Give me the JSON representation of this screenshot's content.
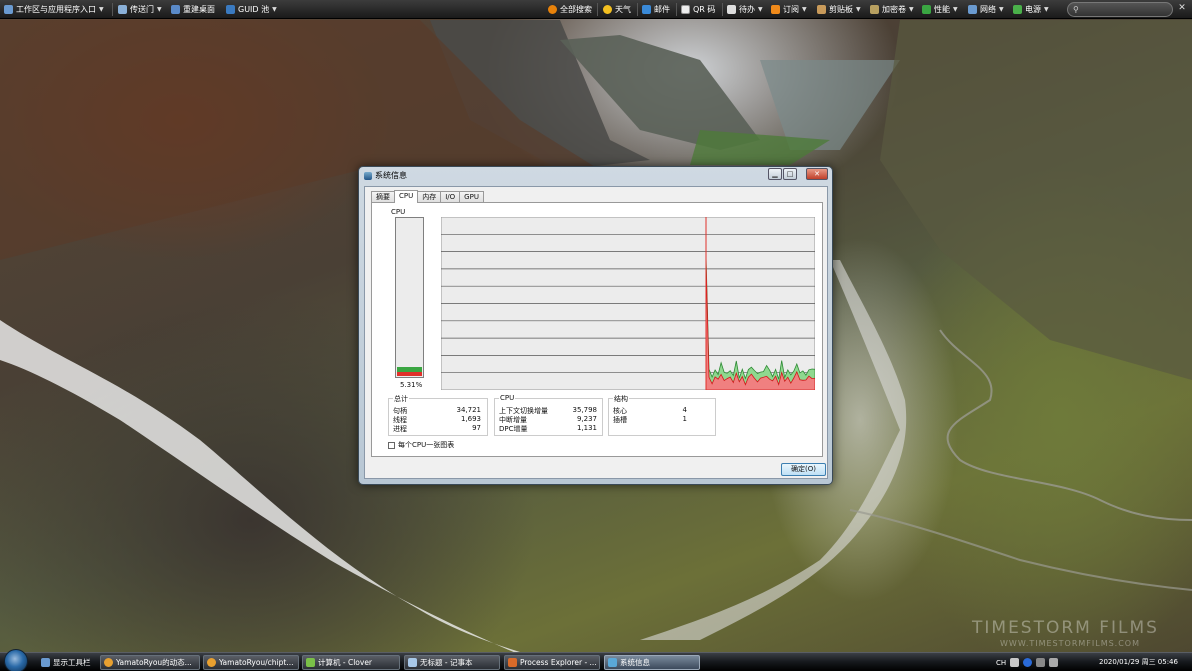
{
  "topbar": {
    "items": [
      {
        "label": "工作区与应用程序入口",
        "icon": "grid-icon"
      },
      {
        "label": "传送门",
        "icon": "portal-icon"
      },
      {
        "label": "重建桌面",
        "icon": "monitor-icon"
      },
      {
        "label": "GUID 池",
        "icon": "guid-icon"
      },
      {
        "label": "全部搜索",
        "icon": "search-icon"
      },
      {
        "label": "天气",
        "icon": "weather-icon"
      },
      {
        "label": "邮件",
        "icon": "mail-icon"
      },
      {
        "label": "QR 码",
        "icon": "qr-icon"
      },
      {
        "label": "待办",
        "icon": "todo-icon"
      },
      {
        "label": "订阅",
        "icon": "rss-icon"
      },
      {
        "label": "剪贴板",
        "icon": "clipboard-icon"
      },
      {
        "label": "加密卷",
        "icon": "encrypt-icon"
      },
      {
        "label": "性能",
        "icon": "performance-icon"
      },
      {
        "label": "网络",
        "icon": "network-icon"
      },
      {
        "label": "电源",
        "icon": "power-icon"
      }
    ]
  },
  "window": {
    "title": "系统信息",
    "tabs": [
      "摘要",
      "CPU",
      "内存",
      "I/O",
      "GPU"
    ],
    "active_tab": "CPU",
    "cpu_label": "CPU",
    "cpu_usage_text": "5.31%",
    "cpu_usage_fraction": 0.0531,
    "totals": {
      "title": "总计",
      "rows": [
        {
          "label": "句柄",
          "value": "34,721"
        },
        {
          "label": "线程",
          "value": "1,693"
        },
        {
          "label": "进程",
          "value": "97"
        }
      ]
    },
    "cpu": {
      "title": "CPU",
      "rows": [
        {
          "label": "上下文切换增量",
          "value": "35,798"
        },
        {
          "label": "中断增量",
          "value": "9,237"
        },
        {
          "label": "DPC增量",
          "value": "1,131"
        }
      ]
    },
    "structure": {
      "title": "结构",
      "rows": [
        {
          "label": "核心",
          "value": "4"
        },
        {
          "label": "插槽",
          "value": "1"
        }
      ]
    },
    "checkbox_label": "每个CPU一张图表",
    "ok_label": "确定(O)",
    "colors": {
      "kernel": "#e0302a",
      "total": "#3aa642"
    }
  },
  "taskbar": {
    "tasks": [
      {
        "label": "显示工具栏",
        "icon": "toolbar-icon"
      },
      {
        "label": "YamatoRyou的动态...",
        "icon": "browser-icon"
      },
      {
        "label": "YamatoRyou/chipt...",
        "icon": "browser-icon"
      },
      {
        "label": "计算机 - Clover",
        "icon": "folder-icon"
      },
      {
        "label": "无标题 - 记事本",
        "icon": "notepad-icon"
      },
      {
        "label": "Process Explorer - ...",
        "icon": "process-icon"
      },
      {
        "label": "系统信息",
        "icon": "sysinfo-icon"
      }
    ],
    "tray_lang": "CH",
    "clock": "2020/01/29 周三 05:46"
  },
  "wallpaper": {
    "watermark": "TIMESTORM FILMS",
    "watermark_url": "WWW.TIMESTORMFILMS.COM"
  }
}
